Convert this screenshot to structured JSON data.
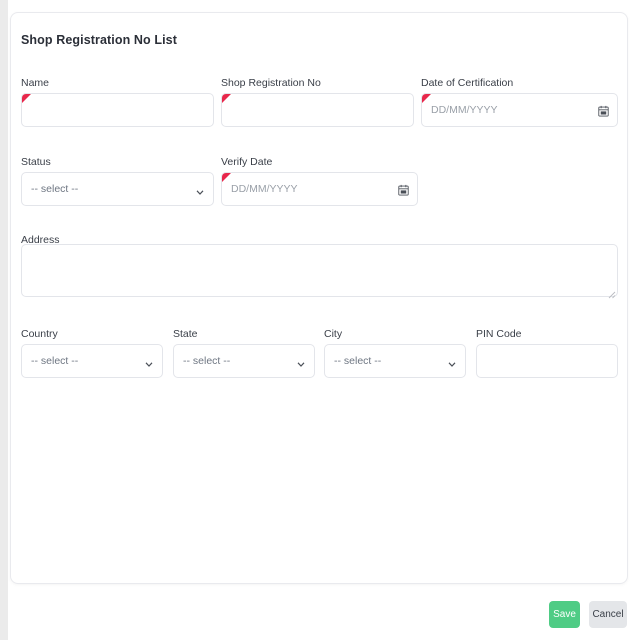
{
  "card": {
    "title": "Shop Registration No List"
  },
  "fields": {
    "name": {
      "label": "Name",
      "value": "",
      "required": true
    },
    "shop_registration_no": {
      "label": "Shop Registration No",
      "value": "",
      "required": true
    },
    "date_of_certification": {
      "label": "Date of Certification",
      "placeholder": "DD/MM/YYYY",
      "value": "",
      "required": true,
      "icon": "calendar-icon"
    },
    "status": {
      "label": "Status",
      "selected": "-- select --",
      "required": false,
      "icon": "chevron-down-icon"
    },
    "verify_date": {
      "label": "Verify Date",
      "placeholder": "DD/MM/YYYY",
      "value": "",
      "required": true,
      "icon": "calendar-icon"
    },
    "address": {
      "label": "Address",
      "value": "",
      "required": false
    },
    "country": {
      "label": "Country",
      "selected": "-- select --",
      "required": false,
      "icon": "chevron-down-icon"
    },
    "state": {
      "label": "State",
      "selected": "-- select --",
      "required": false,
      "icon": "chevron-down-icon"
    },
    "city": {
      "label": "City",
      "selected": "-- select --",
      "required": false,
      "icon": "chevron-down-icon"
    },
    "pin_code": {
      "label": "PIN Code",
      "value": "",
      "required": false
    }
  },
  "footer": {
    "save_label": "Save",
    "cancel_label": "Cancel"
  },
  "colors": {
    "save_green": "#4fcc85",
    "cancel_gray": "#e4e6e9",
    "required_red": "#e8274b",
    "border": "#e3e5ea",
    "label_text": "#3a3f48"
  }
}
